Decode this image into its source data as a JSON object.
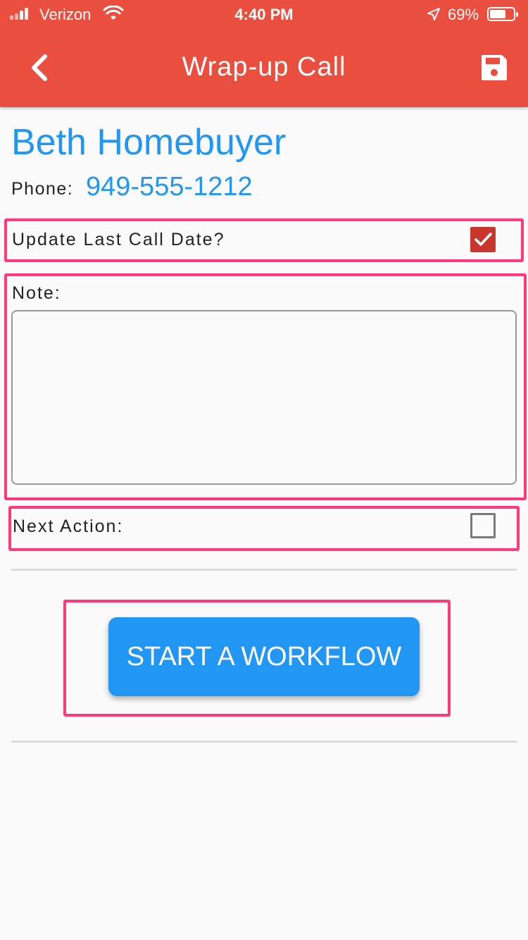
{
  "status_bar": {
    "carrier": "Verizon",
    "time": "4:40 PM",
    "battery_percent": "69%",
    "icons": [
      "signal-icon",
      "wifi-icon",
      "location-arrow-icon",
      "battery-icon"
    ]
  },
  "header": {
    "title": "Wrap-up Call",
    "back_icon": "chevron-left-icon",
    "save_icon": "floppy-disk-icon",
    "background_color": "#e94e3e"
  },
  "contact": {
    "name": "Beth Homebuyer",
    "phone_label": "Phone:",
    "phone_value": "949-555-1212",
    "accent_color": "#2196f3"
  },
  "form": {
    "update_last_call_label": "Update Last Call Date?",
    "update_last_call_checked": true,
    "note_label": "Note:",
    "note_value": "",
    "next_action_label": "Next Action:",
    "next_action_checked": false
  },
  "actions": {
    "start_workflow_label": "START A WORKFLOW"
  },
  "highlight_color": "#ff3a76"
}
